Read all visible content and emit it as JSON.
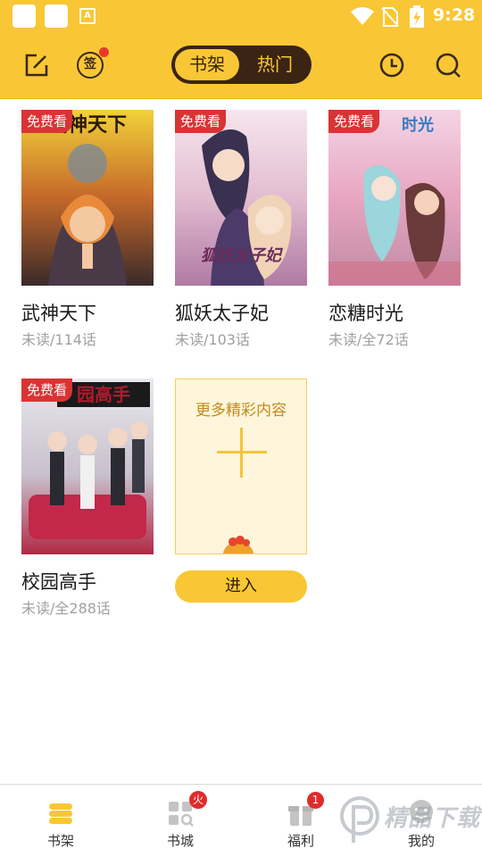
{
  "status_bar": {
    "time": "9:28",
    "app_icon_letter": "A"
  },
  "header": {
    "sign_label": "签",
    "tabs": [
      {
        "label": "书架",
        "active": true
      },
      {
        "label": "热门",
        "active": false
      }
    ],
    "icons": [
      "edit-icon",
      "sign-in-icon",
      "history-clock-icon",
      "search-icon"
    ]
  },
  "shelf": {
    "badge_label": "免费看",
    "books": [
      {
        "title": "武神天下",
        "progress": "未读/114话",
        "cover_text": "武神天下"
      },
      {
        "title": "狐妖太子妃",
        "progress": "未读/103话",
        "cover_text": "狐妖太子妃"
      },
      {
        "title": "恋糖时光",
        "progress": "未读/全72话",
        "cover_text": "时光"
      },
      {
        "title": "校园高手",
        "progress": "未读/全288话",
        "cover_text": "园高手"
      }
    ],
    "more": {
      "text": "更多精彩内容",
      "button": "进入"
    }
  },
  "bottom_nav": {
    "items": [
      {
        "label": "书架",
        "icon": "bookshelf-icon",
        "active": true
      },
      {
        "label": "书城",
        "icon": "bookstore-icon",
        "badge": "火"
      },
      {
        "label": "福利",
        "icon": "gift-icon",
        "badge": "1"
      },
      {
        "label": "我的",
        "icon": "profile-icon"
      }
    ]
  },
  "watermark": {
    "text": "精品下载"
  },
  "colors": {
    "accent": "#f9c735",
    "dark": "#3b2414",
    "tag": "#d93434"
  }
}
